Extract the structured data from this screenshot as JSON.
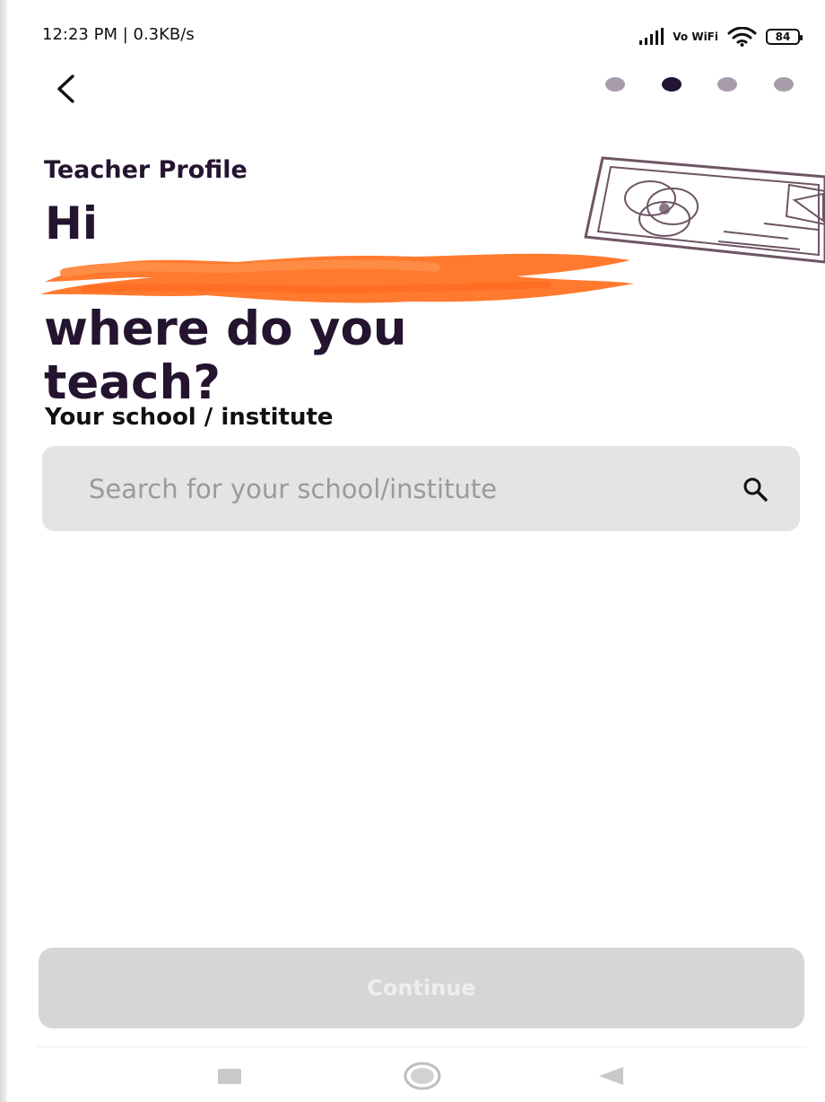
{
  "status_bar": {
    "time_speed": "12:23 PM | 0.3KB/s",
    "vowifi": "Vo WiFi",
    "battery": "84",
    "icons": [
      "signal-bars-icon",
      "vowifi-icon",
      "wifi-icon",
      "battery-icon"
    ]
  },
  "navigation": {
    "back_icon": "chevron-left-icon",
    "active_step": 2,
    "total_steps": 4
  },
  "hero": {
    "profile_label": "Teacher Profile",
    "greeting": "Hi",
    "question_line_1": "where do you",
    "question_line_2": "teach?",
    "illustration_icon": "classroom-board-icon"
  },
  "school_field": {
    "label": "Your school / institute",
    "placeholder": "Search for your school/institute",
    "value": "",
    "icon": "search-icon"
  },
  "actions": {
    "continue_label": "Continue",
    "continue_enabled": false
  },
  "system_nav": {
    "icons": [
      "recent-apps-icon",
      "home-icon",
      "back-icon"
    ]
  },
  "colors": {
    "primary_text": "#24142f",
    "inactive_dot": "#a79cac",
    "input_background": "#e4e4e4",
    "disabled_button": "#d6d6d6",
    "redaction": "#ff7a2f"
  }
}
